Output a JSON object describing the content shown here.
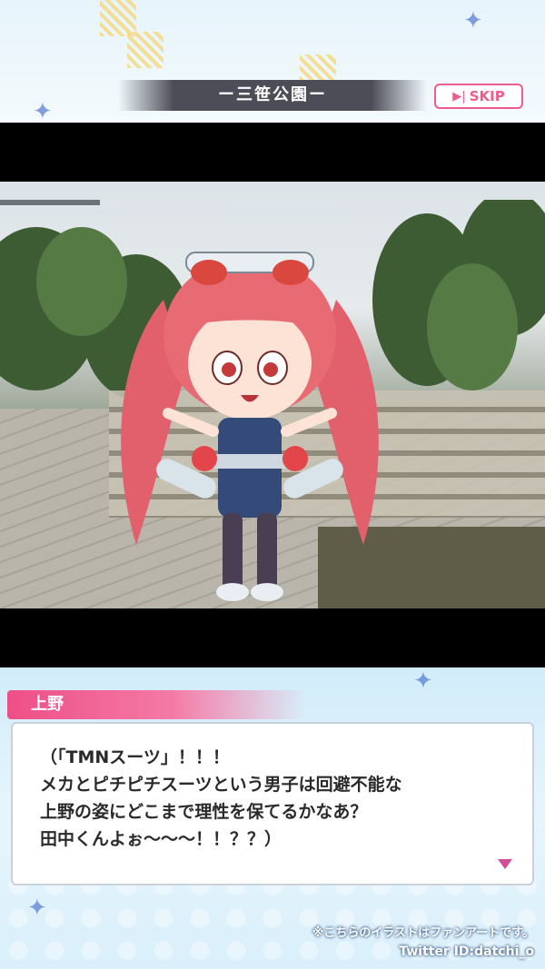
{
  "header": {
    "location_title": "ー三笹公園ー",
    "skip_label": "SKIP",
    "skip_icon": "play-skip-icon"
  },
  "scene": {
    "image_name": "park-background-with-character"
  },
  "dialogue": {
    "speaker": "上野",
    "lines": [
      "（「TMNスーツ」！！！",
      "メカとピチピチスーツという男子は回避不能な",
      "上野の姿にどこまで理性を保てるかなあ？",
      "田中くんよぉ～～～！！？？）"
    ],
    "next_icon": "next-arrow-icon"
  },
  "footer": {
    "notice": "※こちらのイラストはファンアートです。",
    "credit": "Twitter ID:datchi_o"
  },
  "colors": {
    "accent": "#ee5c8c",
    "name_tag": "#ee4f87",
    "location_bar": "#4d4d58"
  }
}
